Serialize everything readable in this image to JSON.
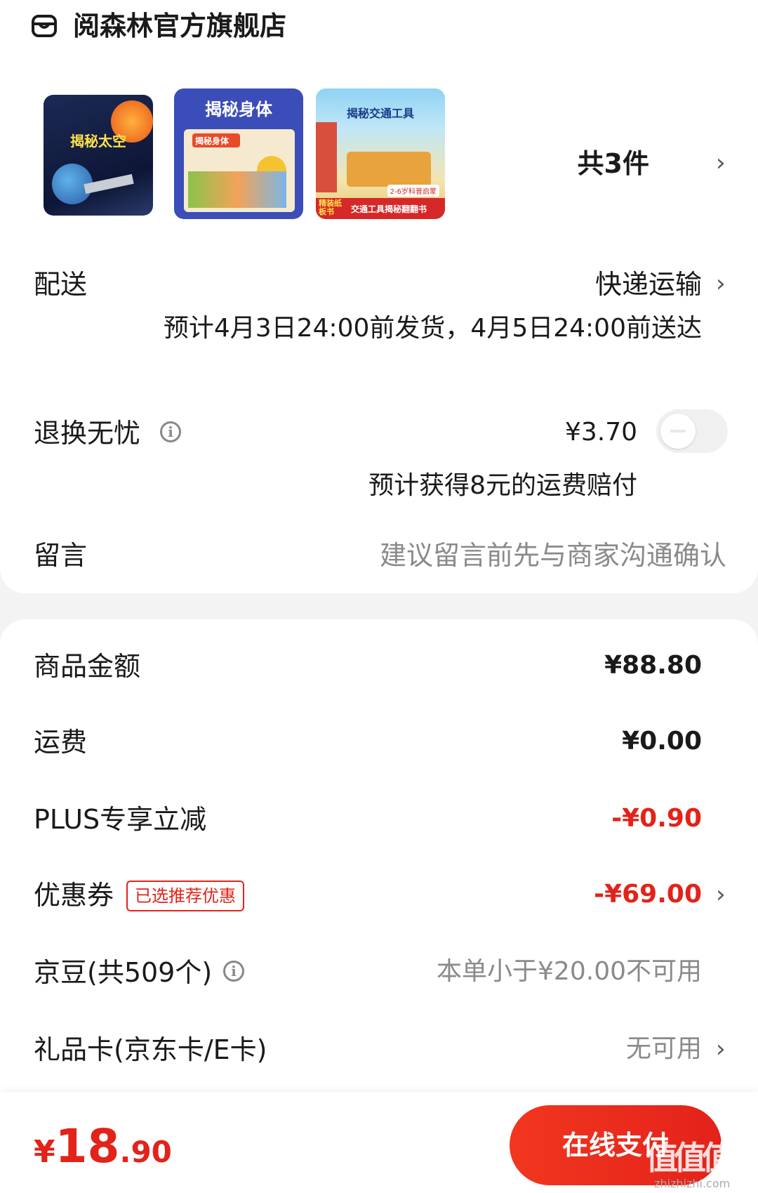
{
  "shop": {
    "name": "阅森林官方旗舰店",
    "icon": "shop-icon"
  },
  "products": {
    "count_label": "共3件",
    "books": [
      {
        "title": "揭秘太空"
      },
      {
        "title": "揭秘身体",
        "subtitle": "揭秘身体"
      },
      {
        "title": "揭秘交通工具",
        "band": "交通工具揭秘翻翻书",
        "tag": "精装纸板书",
        "age": "2-6岁科普启蒙"
      }
    ]
  },
  "delivery": {
    "label": "配送",
    "method": "快递运输",
    "estimate": "预计4月3日24:00前发货，4月5日24:00前送达"
  },
  "return_insurance": {
    "label": "退换无忧",
    "price": "¥3.70",
    "note": "预计获得8元的运费赔付",
    "enabled": false
  },
  "message": {
    "label": "留言",
    "placeholder": "建议留言前先与商家沟通确认"
  },
  "summary": {
    "goods_amount": {
      "label": "商品金额",
      "value": "¥88.80"
    },
    "shipping": {
      "label": "运费",
      "value": "¥0.00"
    },
    "plus_discount": {
      "label": "PLUS专享立减",
      "value": "-¥0.90"
    },
    "coupon": {
      "label": "优惠券",
      "badge": "已选推荐优惠",
      "value": "-¥69.00"
    },
    "jingdou": {
      "label": "京豆(共509个)",
      "value": "本单小于¥20.00不可用"
    },
    "gift_card": {
      "label": "礼品卡(京东卡/E卡)",
      "value": "无可用"
    }
  },
  "footer": {
    "total_symbol": "¥",
    "total_int": "18",
    "total_dec": ".90",
    "pay_label": "在线支付",
    "watermark": "值值值",
    "watermark_url": "zhizhizhi.com"
  },
  "colors": {
    "accent": "#e2231a",
    "muted": "#8a8a8a"
  }
}
